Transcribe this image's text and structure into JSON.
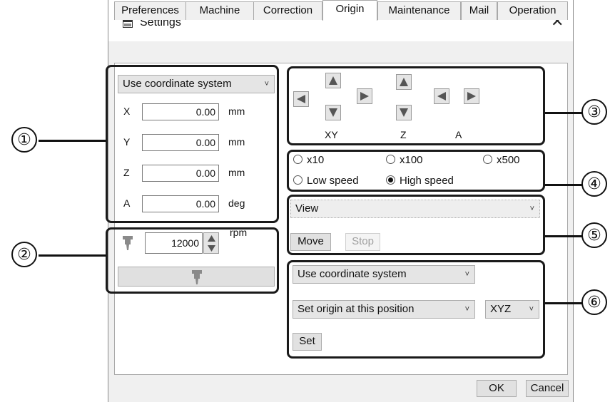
{
  "window": {
    "title": "Settings",
    "close_glyph": "✕"
  },
  "tabs": [
    {
      "label": "Preferences"
    },
    {
      "label": "Machine"
    },
    {
      "label": "Correction"
    },
    {
      "label": "Origin",
      "active": true
    },
    {
      "label": "Maintenance"
    },
    {
      "label": "Mail"
    },
    {
      "label": "Operation"
    }
  ],
  "coords": {
    "system_select": "Use coordinate system",
    "rows": [
      {
        "axis": "X",
        "value": "0.00",
        "unit": "mm"
      },
      {
        "axis": "Y",
        "value": "0.00",
        "unit": "mm"
      },
      {
        "axis": "Z",
        "value": "0.00",
        "unit": "mm"
      },
      {
        "axis": "A",
        "value": "0.00",
        "unit": "deg"
      }
    ]
  },
  "spindle": {
    "speed": "12000",
    "unit": "rpm",
    "icon": "spindle-icon"
  },
  "jog": {
    "labels": {
      "xy": "XY",
      "z": "Z",
      "a": "A"
    }
  },
  "step": {
    "options": [
      "x10",
      "x100",
      "x500"
    ],
    "speed_options": [
      "Low speed",
      "High speed"
    ],
    "selected_speed": "High speed"
  },
  "move": {
    "view_select": "View",
    "move_label": "Move",
    "stop_label": "Stop"
  },
  "origin": {
    "system_select": "Use coordinate system",
    "action_select": "Set origin at this position",
    "axes_select": "XYZ",
    "set_label": "Set"
  },
  "footer": {
    "ok_label": "OK",
    "cancel_label": "Cancel"
  },
  "markers": [
    "①",
    "②",
    "③",
    "④",
    "⑤",
    "⑥"
  ],
  "chevron": "˅",
  "colors": {
    "frame": "#1a1a1a",
    "button": "#e1e1e1",
    "panel": "#ffffff",
    "window": "#f0f0f0"
  }
}
